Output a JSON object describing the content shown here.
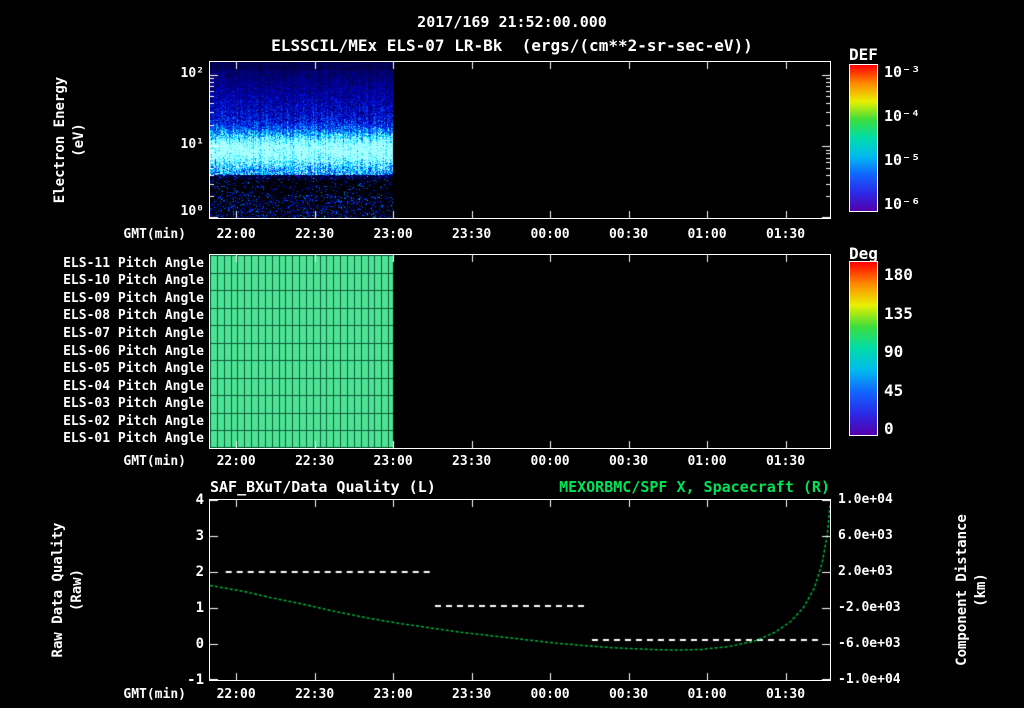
{
  "colors": {
    "background": "#000000",
    "text": "#ffffff",
    "green_text": "#00e356",
    "pitch_green": "#4ee394",
    "pitch_grid": "#0b5c36",
    "rainbow": [
      "#ff0000",
      "#ff8800",
      "#e8f000",
      "#3ddd3d",
      "#00ddaa",
      "#00bbee",
      "#1166ff",
      "#2a2ae8",
      "#5500aa"
    ]
  },
  "header": {
    "timestamp": "2017/169 21:52:00.000",
    "title": "ELSSCIL/MEx ELS-07 LR-Bk  (ergs/(cm**2-sr-sec-eV))"
  },
  "time_axis": {
    "label": "GMT(min)",
    "ticks": [
      "22:00",
      "22:30",
      "23:00",
      "23:30",
      "00:00",
      "00:30",
      "01:00",
      "01:30"
    ],
    "tick_min": [
      10,
      40,
      70,
      100,
      130,
      160,
      190,
      220
    ],
    "total_min": 237
  },
  "panel1": {
    "ylabel": [
      "Electron Energy",
      "(eV)"
    ],
    "y_ticks": [
      "10²",
      "10¹",
      "10⁰"
    ],
    "colorbar": {
      "label": "DEF",
      "ticks": [
        "10⁻³",
        "10⁻⁴",
        "10⁻⁵",
        "10⁻⁶"
      ]
    }
  },
  "panel2": {
    "rows": [
      "ELS-11 Pitch Angle",
      "ELS-10 Pitch Angle",
      "ELS-09 Pitch Angle",
      "ELS-08 Pitch Angle",
      "ELS-07 Pitch Angle",
      "ELS-06 Pitch Angle",
      "ELS-05 Pitch Angle",
      "ELS-04 Pitch Angle",
      "ELS-03 Pitch Angle",
      "ELS-02 Pitch Angle",
      "ELS-01 Pitch Angle"
    ],
    "colorbar": {
      "label": "Deg",
      "ticks": [
        "180",
        "135",
        "90",
        "45",
        "0"
      ]
    }
  },
  "panel3": {
    "title_left": "SAF_BXuT/Data Quality (L)",
    "title_right": "MEXORBMC/SPF X, Spacecraft (R)",
    "ylabel_left": [
      "Raw Data Quality",
      "(Raw)"
    ],
    "ylabel_right": [
      "Component Distance",
      "(km)"
    ],
    "left_ticks": [
      "4",
      "3",
      "2",
      "1",
      "0",
      "-1"
    ],
    "right_ticks": [
      "1.0e+04",
      "6.0e+03",
      "2.0e+03",
      "-2.0e+03",
      "-6.0e+03",
      "-1.0e+04"
    ]
  },
  "chart_data": [
    {
      "type": "heatmap",
      "title": "ELSSCIL/MEx ELS-07 LR-Bk (ergs/(cm**2-sr-sec-eV))",
      "xlabel": "GMT(min)",
      "ylabel": "Electron Energy (eV)",
      "y_scale": "log",
      "y_range_ev": [
        1,
        200
      ],
      "colorbar_label": "DEF",
      "colorbar_range": [
        "1e-3",
        "1e-6"
      ],
      "x_axis_start": "21:52",
      "data_start_min": 0,
      "data_end_min": 70,
      "bands": [
        {
          "energy_ev": [
            5,
            20
          ],
          "def_level": "~1e-4 bright cyan band"
        },
        {
          "energy_ev": [
            20,
            160
          ],
          "def_level": "~1e-5 blue speckle"
        },
        {
          "energy_ev": [
            1,
            4
          ],
          "def_level": "sparse faint noise"
        }
      ],
      "note": "no data after 23:00"
    },
    {
      "type": "heatmap",
      "xlabel": "GMT(min)",
      "rows_top_to_bottom": [
        "ELS-11",
        "ELS-10",
        "ELS-09",
        "ELS-08",
        "ELS-07",
        "ELS-06",
        "ELS-05",
        "ELS-04",
        "ELS-03",
        "ELS-02",
        "ELS-01"
      ],
      "colorbar_label": "Deg",
      "value_range_deg": [
        0,
        180
      ],
      "approx_uniform_value_deg": 100,
      "data_start_min": 0,
      "data_end_min": 70,
      "note": "uniform green pitch-angle cells from 21:52 to 23:00, black (no data) after"
    },
    {
      "type": "line",
      "xlabel": "GMT(min)",
      "x_axis_note": "t in minutes from left axis edge (approx 21:50), total 237",
      "left_axis": {
        "label": "Raw Data Quality (Raw)",
        "range": [
          -1,
          4
        ]
      },
      "right_axis": {
        "label": "Component Distance (km)",
        "range": [
          -10000,
          10000
        ]
      },
      "series": [
        {
          "name": "SAF_BXuT/Data Quality (L)",
          "axis": "left",
          "style": "dashed",
          "color": "#ffffff",
          "segments": [
            {
              "t": [
                6,
                84
              ],
              "value": 2.0
            },
            {
              "t": [
                86,
                144
              ],
              "value": 1.05
            },
            {
              "t": [
                146,
                233
              ],
              "value": 0.1
            }
          ]
        },
        {
          "name": "MEXORBMC/SPF X, Spacecraft (R)",
          "axis": "right",
          "style": "dotted",
          "color": "#00b244",
          "points": [
            [
              0,
              500
            ],
            [
              12,
              -100
            ],
            [
              24,
              -900
            ],
            [
              36,
              -1600
            ],
            [
              48,
              -2400
            ],
            [
              60,
              -3100
            ],
            [
              72,
              -3700
            ],
            [
              84,
              -4200
            ],
            [
              96,
              -4700
            ],
            [
              108,
              -5100
            ],
            [
              120,
              -5500
            ],
            [
              132,
              -5900
            ],
            [
              144,
              -6200
            ],
            [
              156,
              -6450
            ],
            [
              168,
              -6600
            ],
            [
              178,
              -6680
            ],
            [
              188,
              -6600
            ],
            [
              198,
              -6300
            ],
            [
              208,
              -5700
            ],
            [
              216,
              -4700
            ],
            [
              222,
              -3500
            ],
            [
              227,
              -1900
            ],
            [
              231,
              200
            ],
            [
              234,
              3000
            ],
            [
              236,
              6200
            ],
            [
              237,
              9400
            ]
          ]
        }
      ]
    }
  ]
}
